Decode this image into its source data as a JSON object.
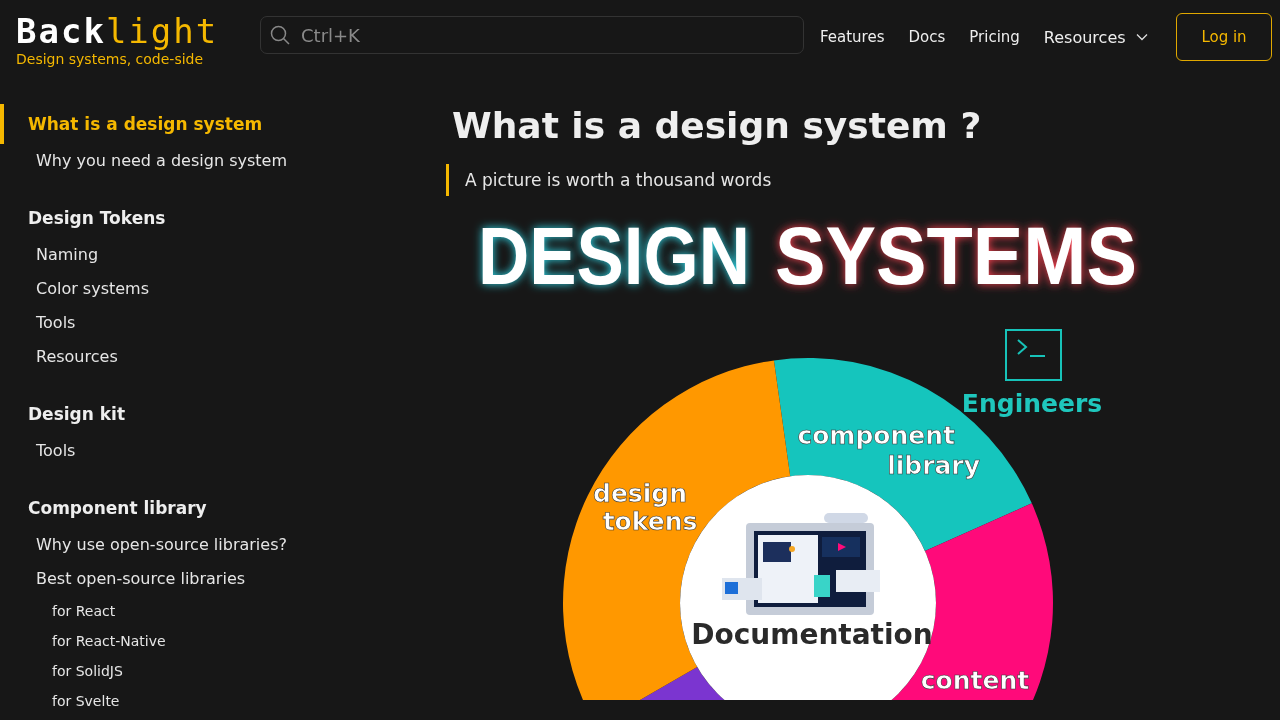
{
  "header": {
    "logo": {
      "primary": "Back",
      "accent": "light"
    },
    "tagline": "Design systems, code-side",
    "search": {
      "placeholder": "Ctrl+K"
    },
    "nav": [
      {
        "label": "Features",
        "kind": "link"
      },
      {
        "label": "Docs",
        "kind": "link"
      },
      {
        "label": "Pricing",
        "kind": "link"
      },
      {
        "label": "Resources",
        "kind": "dropdown"
      }
    ],
    "login_button": "Log in"
  },
  "sidebar": {
    "sections": [
      {
        "title": "What is a design system",
        "selected": true,
        "children": [
          {
            "label": "Why you need a design system",
            "selected": false
          }
        ]
      },
      {
        "title": "Design Tokens",
        "selected": false,
        "children": [
          {
            "label": "Naming",
            "selected": false
          },
          {
            "label": "Color systems",
            "selected": false
          },
          {
            "label": "Tools",
            "selected": false
          },
          {
            "label": "Resources",
            "selected": false
          }
        ]
      },
      {
        "title": "Design kit",
        "selected": false,
        "children": [
          {
            "label": "Tools",
            "selected": false
          }
        ]
      },
      {
        "title": "Component library",
        "selected": false,
        "children": [
          {
            "label": "Why use open-source libraries?",
            "selected": false
          },
          {
            "label": "Best open-source libraries",
            "selected": false,
            "children": [
              {
                "label": "for React",
                "selected": false
              },
              {
                "label": "for React-Native",
                "selected": false
              },
              {
                "label": "for SolidJS",
                "selected": false
              },
              {
                "label": "for Svelte",
                "selected": false
              }
            ]
          }
        ]
      }
    ]
  },
  "article": {
    "title": "What is a design system ?",
    "quote": "A picture is worth a thousand words",
    "infographic": {
      "heading": [
        "DESIGN",
        "SYSTEMS"
      ],
      "engineers_label": "Engineers",
      "center_label": "Documentation",
      "segments": [
        {
          "color": "#15c5bd",
          "lines": [
            "component",
            "library"
          ]
        },
        {
          "color": "#ff0a7a",
          "lines": [
            "content"
          ]
        },
        {
          "color": "#7b35d0"
        },
        {
          "color": "#ff9800",
          "lines": [
            "design",
            "tokens"
          ]
        }
      ]
    }
  }
}
